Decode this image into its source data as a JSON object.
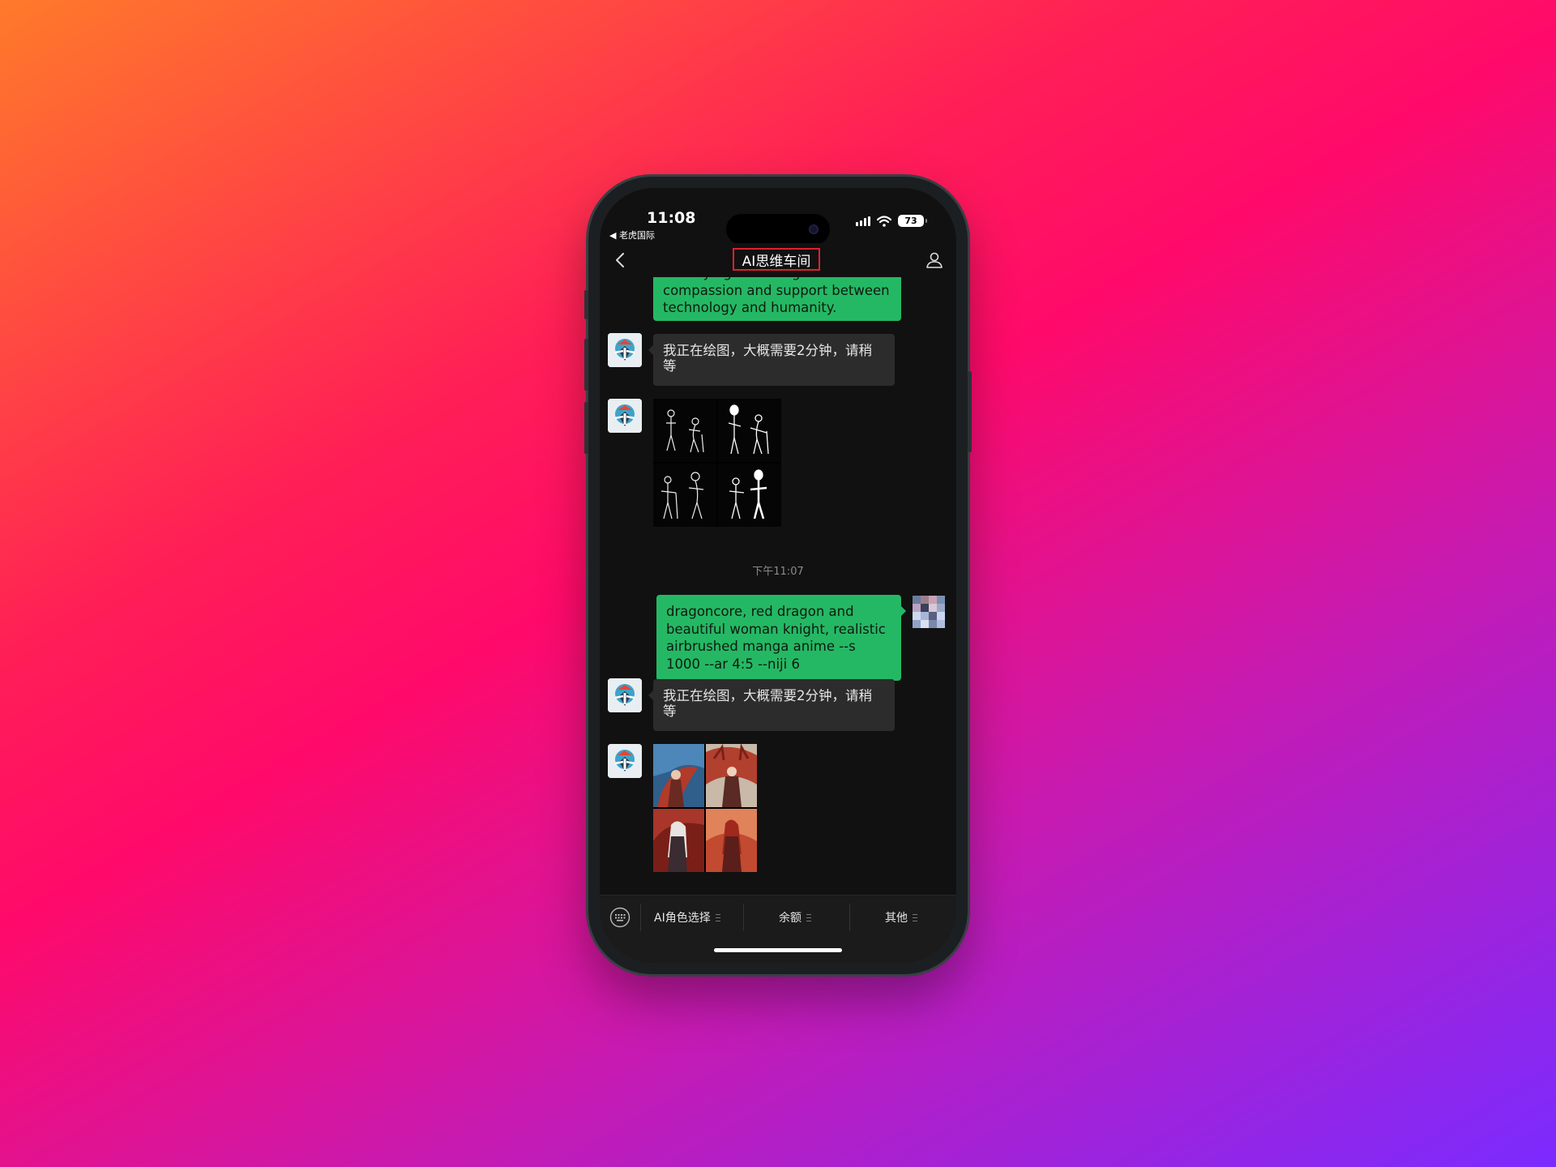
{
  "status": {
    "time": "11:08",
    "back_app": "◀ 老虎国际",
    "battery": "73",
    "icons": [
      "signal-icon",
      "wifi-icon",
      "battery-icon"
    ]
  },
  "nav": {
    "title": "AI思维车间",
    "back_icon": "chevron-left-icon",
    "profile_icon": "person-icon"
  },
  "messages": [
    {
      "type": "user_text",
      "text": "conveying a message of compassion and support between technology and humanity."
    },
    {
      "type": "bot_text",
      "text": "我正在绘图，大概需要2分钟，请稍等"
    },
    {
      "type": "bot_image",
      "description_icon": "robot-and-elder-sketch-grid"
    },
    {
      "type": "timestamp",
      "text": "下午11:07"
    },
    {
      "type": "user_text",
      "text": "dragoncore, red dragon and beautiful woman knight, realistic airbrushed manga anime --s 1000 --ar 4:5 --niji 6"
    },
    {
      "type": "bot_text",
      "text": "我正在绘图，大概需要2分钟，请稍等"
    },
    {
      "type": "bot_image",
      "description_icon": "dragon-knight-art-grid"
    }
  ],
  "menu": {
    "keyboard_icon": "keyboard-icon",
    "items": [
      {
        "label": "AI角色选择"
      },
      {
        "label": "余额"
      },
      {
        "label": "其他"
      }
    ]
  },
  "colors": {
    "bubble_green": "#25b864",
    "bubble_gray": "#2c2c2c",
    "title_highlight": "#e02030"
  }
}
